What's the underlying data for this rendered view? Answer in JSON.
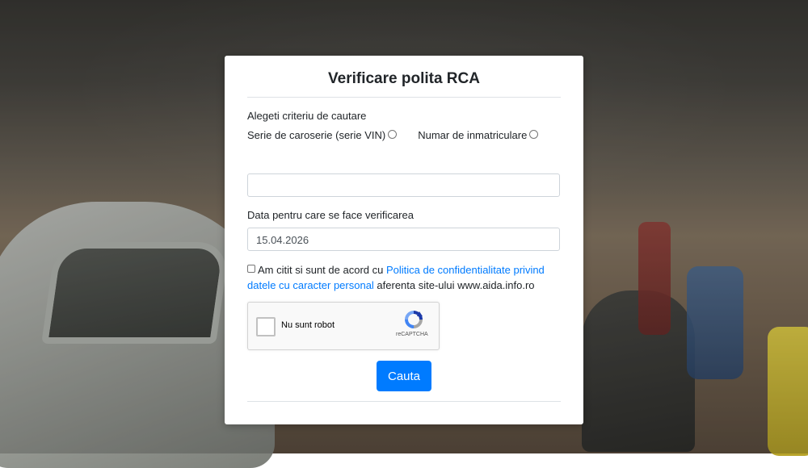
{
  "form": {
    "title": "Verificare polita RCA",
    "criteria_label": "Alegeti criteriu de cautare",
    "radio_options": [
      {
        "label": "Serie de caroserie (serie VIN)"
      },
      {
        "label": "Numar de inmatriculare"
      }
    ],
    "search_input": {
      "value": "",
      "placeholder": ""
    },
    "date_label": "Data pentru care se face verificarea",
    "date_value": "15.04.2026",
    "consent": {
      "text_before": "Am citit si sunt de acord cu ",
      "link_text": "Politica de confidentialitate privind datele cu caracter personal",
      "text_after": " aferenta site-ului www.aida.info.ro"
    },
    "recaptcha": {
      "label": "Nu sunt robot",
      "brand": "reCAPTCHA"
    },
    "submit_label": "Cauta"
  },
  "colors": {
    "accent": "#007bff",
    "link": "#007bff",
    "text": "#212529",
    "card_bg": "#ffffff"
  }
}
